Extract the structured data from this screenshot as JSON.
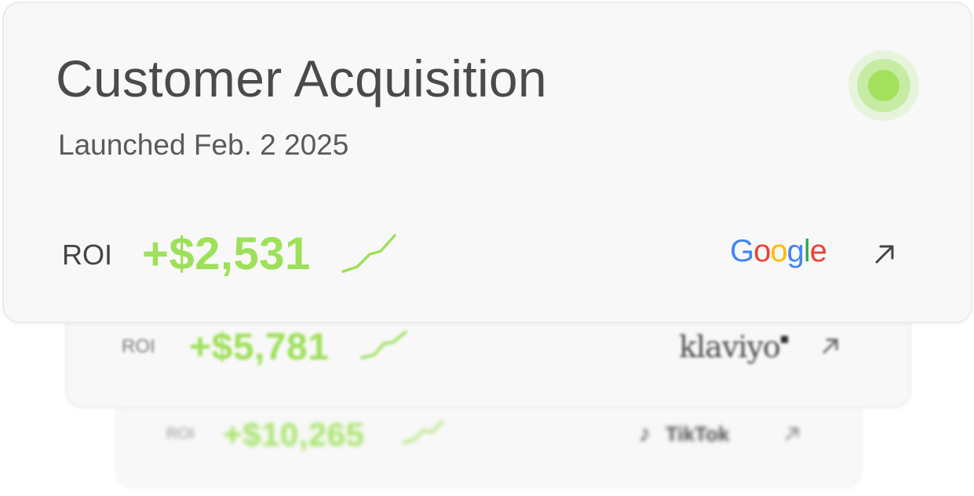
{
  "campaign": {
    "title": "Customer Acquisition",
    "launched": "Launched Feb. 2 2025",
    "status_color": "#a3e05c"
  },
  "channels": [
    {
      "roi_label": "ROI",
      "roi_value": "+$2,531",
      "logo": "Google",
      "logo_icon": "google-logo",
      "link_icon": "arrow-up-right-icon"
    },
    {
      "roi_label": "ROI",
      "roi_value": "+$5,781",
      "logo": "klaviyo",
      "logo_icon": "klaviyo-logo",
      "link_icon": "arrow-up-right-icon"
    },
    {
      "roi_label": "ROI",
      "roi_value": "+$10,265",
      "logo": "TikTok",
      "logo_icon": "tiktok-logo",
      "link_icon": "arrow-up-right-icon"
    }
  ],
  "colors": {
    "accent_green": "#9ee05a",
    "card_bg": "#f8f8f8",
    "text": "#4a4a4a"
  }
}
